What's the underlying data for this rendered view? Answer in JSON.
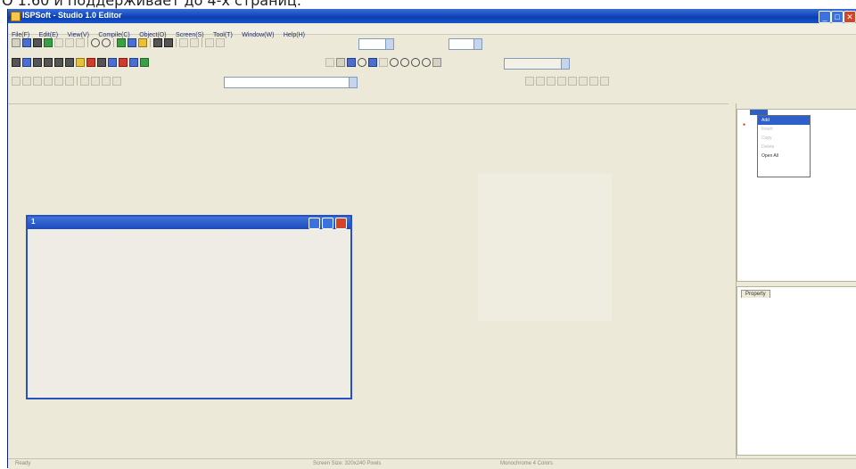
{
  "caption": {
    "text": "O 1.60 и поддерживает до 4-х страниц."
  },
  "window": {
    "title": "ISPSoft - Studio 1.0 Editor",
    "minimize_label": "_",
    "maximize_label": "□",
    "close_label": "✕"
  },
  "menubar": {
    "items": [
      "File(F)",
      "Edit(E)",
      "View(V)",
      "Compile(C)",
      "Object(O)",
      "Screen(S)",
      "Tool(T)",
      "Window(W)",
      "Help(H)"
    ]
  },
  "toolbar": {
    "font_placeholder": "",
    "zoom_value": "",
    "size_value": ""
  },
  "document": {
    "title": "1"
  },
  "tree": {
    "context_menu": [
      "Add",
      "Insert",
      "Copy",
      "Delete",
      "Open All"
    ]
  },
  "properties": {
    "tab_label": "Property"
  },
  "statusbar": {
    "left": "Ready",
    "center": "Screen Size: 320x240 Pixels",
    "right": "Monochrome 4 Colors"
  },
  "colors": {
    "title_blue": "#0a3fb4",
    "document_border": "#2852c2",
    "background": "#ece9d8",
    "close_red": "#d2452b"
  }
}
